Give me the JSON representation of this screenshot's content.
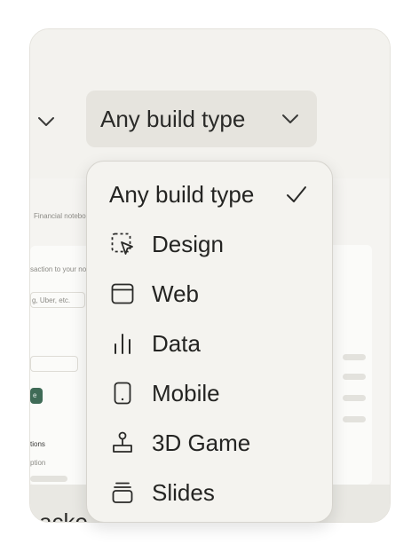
{
  "filter": {
    "selected_label": "Any build type"
  },
  "background": {
    "bottom_text_fragment": "acke"
  },
  "background_preview": {
    "tab_text": "Financial notebook",
    "desc_text": "saction to your noteb",
    "input_placeholder": "g, Uber, etc.",
    "button_text": "e",
    "section_title": "tions",
    "column_header": "ption"
  },
  "menu": {
    "items": [
      {
        "label": "Any build type",
        "icon": "check-icon",
        "selected": true
      },
      {
        "label": "Design",
        "icon": "select-cursor-icon"
      },
      {
        "label": "Web",
        "icon": "browser-window-icon"
      },
      {
        "label": "Data",
        "icon": "bar-chart-icon"
      },
      {
        "label": "Mobile",
        "icon": "mobile-phone-icon"
      },
      {
        "label": "3D Game",
        "icon": "joystick-icon"
      },
      {
        "label": "Slides",
        "icon": "slides-stack-icon"
      }
    ]
  }
}
